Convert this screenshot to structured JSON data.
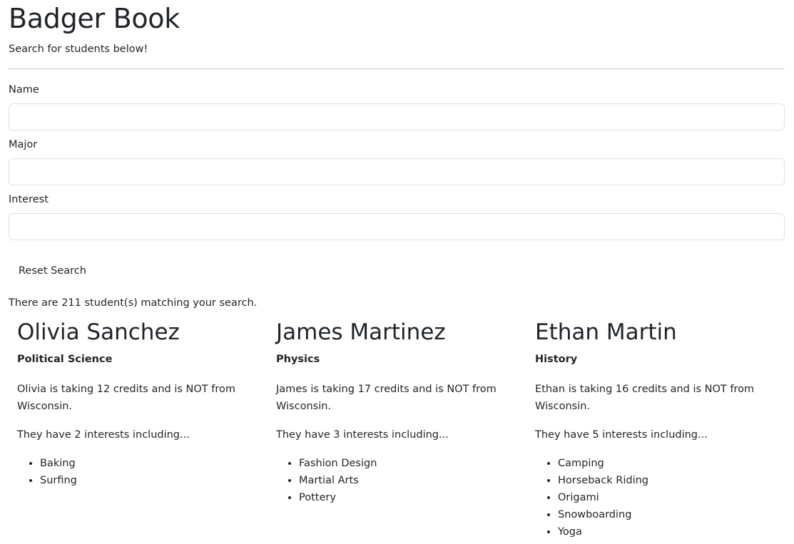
{
  "header": {
    "title": "Badger Book",
    "subtitle": "Search for students below!"
  },
  "search": {
    "name_label": "Name",
    "name_value": "",
    "major_label": "Major",
    "major_value": "",
    "interest_label": "Interest",
    "interest_value": "",
    "reset_label": "Reset Search"
  },
  "results": {
    "summary": "There are 211 student(s) matching your search."
  },
  "students": [
    {
      "name": "Olivia Sanchez",
      "major": "Political Science",
      "credits_text": "Olivia is taking 12 credits and is NOT from Wisconsin.",
      "interests_text": "They have 2 interests including...",
      "interests": [
        "Baking",
        "Surfing"
      ]
    },
    {
      "name": "James Martinez",
      "major": "Physics",
      "credits_text": "James is taking 17 credits and is NOT from Wisconsin.",
      "interests_text": "They have 3 interests including...",
      "interests": [
        "Fashion Design",
        "Martial Arts",
        "Pottery"
      ]
    },
    {
      "name": "Ethan Martin",
      "major": "History",
      "credits_text": "Ethan is taking 16 credits and is NOT from Wisconsin.",
      "interests_text": "They have 5 interests including...",
      "interests": [
        "Camping",
        "Horseback Riding",
        "Origami",
        "Snowboarding",
        "Yoga"
      ]
    }
  ]
}
